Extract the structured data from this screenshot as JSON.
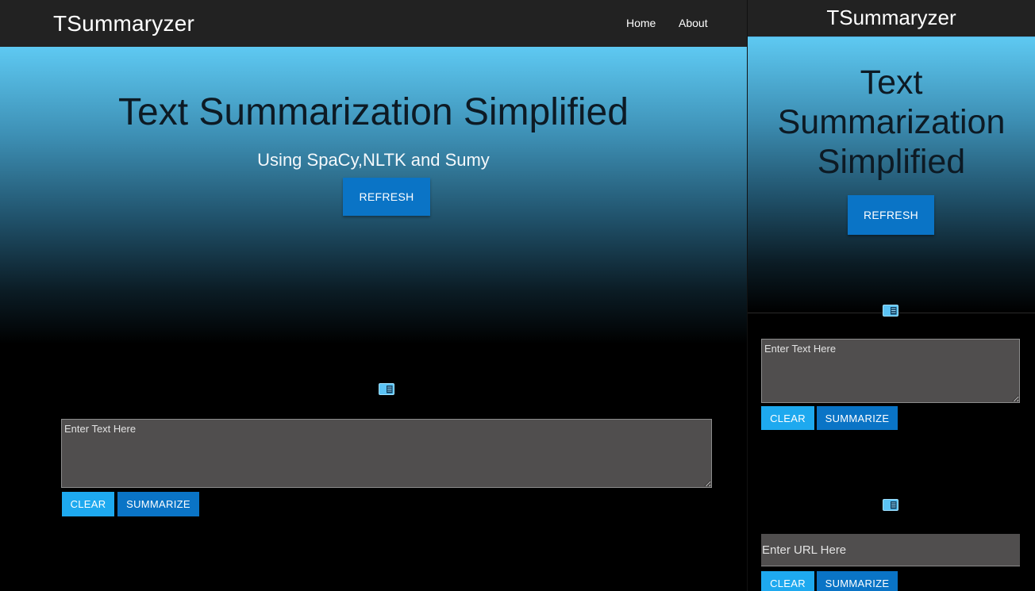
{
  "app": {
    "brand": "TSummaryzer"
  },
  "nav": {
    "home": "Home",
    "about": "About"
  },
  "hero": {
    "title": "Text Summarization Simplified",
    "subtitle": "Using SpaCy,NLTK and Sumy",
    "refresh_label": "REFRESH"
  },
  "text_form": {
    "placeholder": "Enter Text Here",
    "clear_label": "CLEAR",
    "summarize_label": "SUMMARIZE"
  },
  "url_form": {
    "placeholder": "Enter URL Here",
    "clear_label": "CLEAR",
    "summarize_label": "SUMMARIZE"
  },
  "icons": {
    "form_section": "document-icon"
  },
  "colors": {
    "navbar": "#222222",
    "primary_button": "#0a74c6",
    "light_button": "#1ea9ef",
    "input_background": "#504e4e",
    "hero_gradient_top": "#5ec9f2",
    "hero_gradient_bottom": "#000000"
  }
}
